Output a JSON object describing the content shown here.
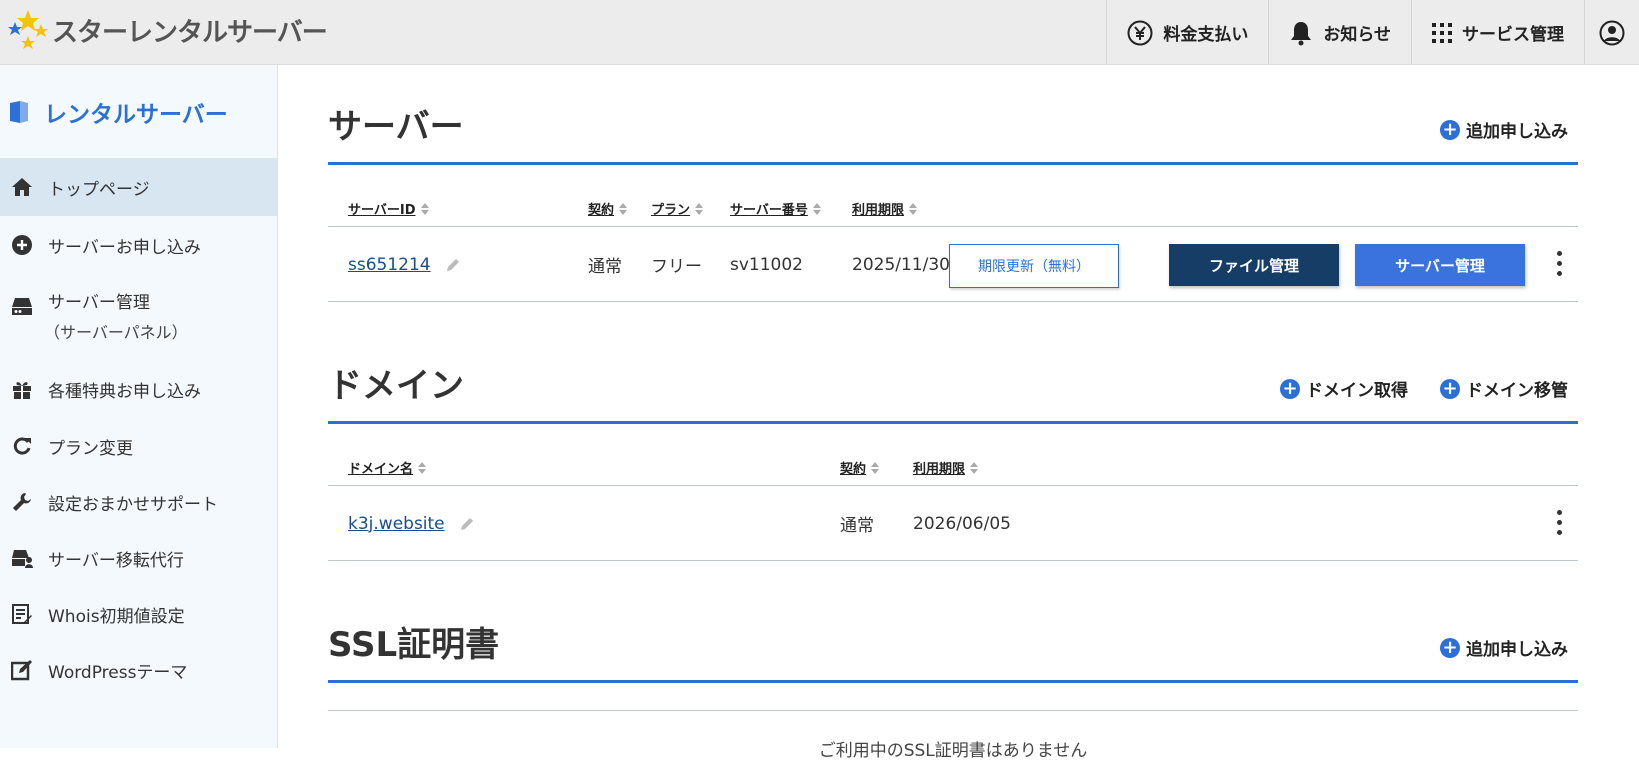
{
  "header": {
    "logo_text": "スターレンタルサーバー",
    "nav": {
      "billing": "料金支払い",
      "notice": "お知らせ",
      "services": "サービス管理"
    }
  },
  "sidebar": {
    "title": "レンタルサーバー",
    "items": [
      {
        "label": "トップページ"
      },
      {
        "label": "サーバーお申し込み"
      },
      {
        "label": "サーバー管理",
        "sub": "（サーバーパネル）"
      },
      {
        "label": "各種特典お申し込み"
      },
      {
        "label": "プラン変更"
      },
      {
        "label": "設定おまかせサポート"
      },
      {
        "label": "サーバー移転代行"
      },
      {
        "label": "Whois初期値設定"
      },
      {
        "label": "WordPressテーマ"
      }
    ]
  },
  "server": {
    "title": "サーバー",
    "add_label": "追加申し込み",
    "columns": [
      "サーバーID",
      "契約",
      "プラン",
      "サーバー番号",
      "利用期限"
    ],
    "row": {
      "id": "ss651214",
      "contract": "通常",
      "plan": "フリー",
      "server_no": "sv11002",
      "expiry": "2025/11/30",
      "renew_btn": "期限更新（無料）",
      "file_btn": "ファイル管理",
      "server_btn": "サーバー管理"
    }
  },
  "domain": {
    "title": "ドメイン",
    "get_label": "ドメイン取得",
    "transfer_label": "ドメイン移管",
    "columns": [
      "ドメイン名",
      "契約",
      "利用期限"
    ],
    "row": {
      "name": "k3j.website",
      "contract": "通常",
      "expiry": "2026/06/05"
    }
  },
  "ssl": {
    "title": "SSL証明書",
    "add_label": "追加申し込み",
    "empty": "ご利用中のSSL証明書はありません"
  },
  "colors": {
    "accent": "#2c6fd6",
    "dark_button": "#163d66",
    "blue_button": "#3a73dd",
    "sidebar_bg": "#f4f9fd",
    "active_item": "#d8e6f1"
  }
}
